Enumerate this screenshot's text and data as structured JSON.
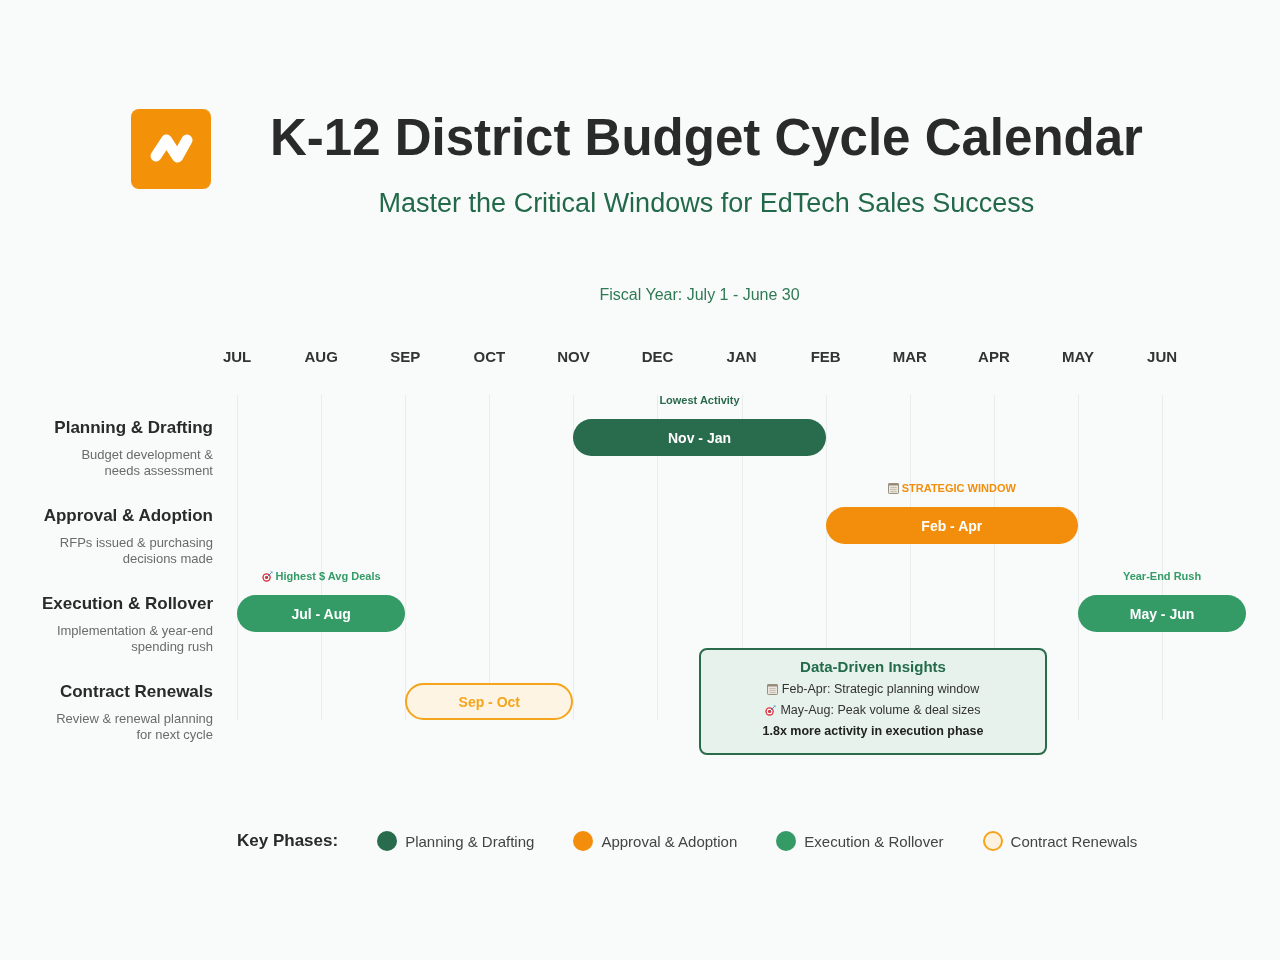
{
  "header": {
    "title": "K-12 District Budget Cycle Calendar",
    "subtitle": "Master the Critical Windows for EdTech Sales Success"
  },
  "timeline": {
    "caption": "Fiscal Year: July 1 - June 30",
    "months": [
      "JUL",
      "AUG",
      "SEP",
      "OCT",
      "NOV",
      "DEC",
      "JAN",
      "FEB",
      "MAR",
      "APR",
      "MAY",
      "JUN"
    ]
  },
  "phases": [
    {
      "name": "Planning & Drafting",
      "description": "Budget development & needs assessment",
      "color": "#286b4d",
      "kind": "solid",
      "bars": [
        {
          "label": "Nov - Jan",
          "note": {
            "text": "Lowest Activity",
            "kind": "plain"
          }
        }
      ]
    },
    {
      "name": "Approval & Adoption",
      "description": "RFPs issued & purchasing decisions made",
      "color": "#f28e0c",
      "kind": "solid",
      "bars": [
        {
          "label": "Feb - Apr",
          "note": {
            "text": "STRATEGIC WINDOW",
            "kind": "window"
          }
        }
      ]
    },
    {
      "name": "Execution & Rollover",
      "description": "Implementation & year-end spending rush",
      "color": "#349b66",
      "kind": "solid",
      "bars": [
        {
          "label": "Jul - Aug",
          "note": {
            "text": "Highest $ Avg Deals",
            "kind": "peak"
          }
        },
        {
          "label": "May - Jun",
          "note": {
            "text": "Year-End Rush",
            "kind": "plain"
          }
        }
      ]
    },
    {
      "name": "Contract Renewals",
      "description": "Review & renewal planning for next cycle",
      "color": "#f4a51c",
      "kind": "outline",
      "bars": [
        {
          "label": "Sep - Oct"
        }
      ]
    }
  ],
  "insights": {
    "title": "Data-Driven Insights",
    "lines": [
      {
        "text": "Feb-Apr: Strategic planning window",
        "kind": "window"
      },
      {
        "text": "May-Aug: Peak volume & deal sizes",
        "kind": "peak"
      },
      {
        "text": "1.8x more activity in execution phase",
        "kind": "summary"
      }
    ]
  },
  "legend": {
    "title": "Key Phases:",
    "items": [
      {
        "label": "Planning & Drafting",
        "color": "#286b4d",
        "kind": "solid"
      },
      {
        "label": "Approval & Adoption",
        "color": "#f28e0c",
        "kind": "solid"
      },
      {
        "label": "Execution & Rollover",
        "color": "#349b66",
        "kind": "solid"
      },
      {
        "label": "Contract Renewals",
        "color": "#f4a51c",
        "kind": "outline"
      }
    ]
  }
}
